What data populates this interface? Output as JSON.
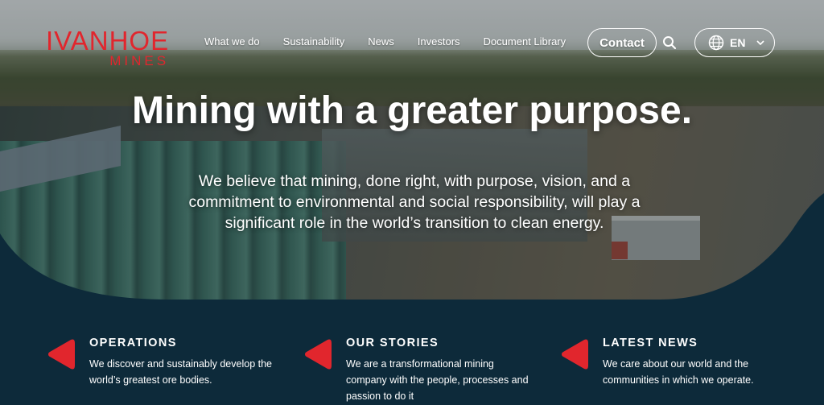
{
  "brand": {
    "name": "IVANHOE",
    "sub": "MINES",
    "color": "#e1262d"
  },
  "nav": {
    "items": [
      "What we do",
      "Sustainability",
      "News",
      "Investors",
      "Document Library"
    ],
    "contact_label": "Contact",
    "search_icon": "search-icon",
    "language": "EN"
  },
  "hero": {
    "title": "Mining with a greater purpose.",
    "text": "We believe that mining, done right, with purpose, vision, and a commitment to environmental and social responsibility, will play a significant role in the world’s transition to clean energy."
  },
  "cards": [
    {
      "title": "OPERATIONS",
      "text": "We discover and sustainably develop the world’s greatest ore bodies."
    },
    {
      "title": "OUR STORIES",
      "text": "We are a transformational mining company with the people, processes and passion to do it"
    },
    {
      "title": "LATEST NEWS",
      "text": "We care about our world and the communities in which we operate."
    }
  ],
  "colors": {
    "dark": "#0d2a3a",
    "accent": "#e1262d"
  }
}
